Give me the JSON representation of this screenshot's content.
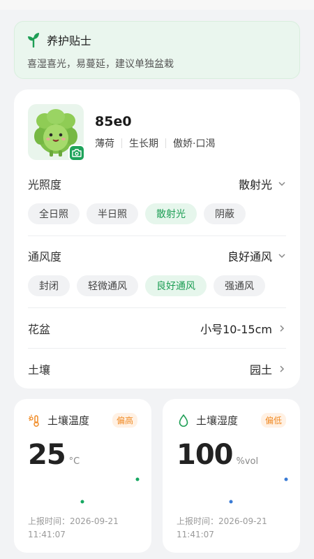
{
  "tip": {
    "title": "养护贴士",
    "text": "喜湿喜光，易蔓延，建议单独盆栽"
  },
  "plant": {
    "name": "85e0",
    "tags": [
      "薄荷",
      "生长期",
      "傲娇·口渴"
    ]
  },
  "light": {
    "label": "光照度",
    "value": "散射光",
    "options": [
      "全日照",
      "半日照",
      "散射光",
      "阴蔽"
    ],
    "selected_index": 2
  },
  "ventilation": {
    "label": "通风度",
    "value": "良好通风",
    "options": [
      "封闭",
      "轻微通风",
      "良好通风",
      "强通风"
    ],
    "selected_index": 2
  },
  "pot": {
    "label": "花盆",
    "value": "小号10-15cm"
  },
  "soil": {
    "label": "土壤",
    "value": "园土"
  },
  "temperature": {
    "title": "土壤温度",
    "badge": "偏高",
    "value": "25",
    "unit": "°C",
    "time_label": "上报时间：",
    "date": "2026-09-21",
    "time": "11:41:07",
    "color": "#16a862"
  },
  "humidity": {
    "title": "土壤湿度",
    "badge": "偏低",
    "value": "100",
    "unit": "%vol",
    "time_label": "上报时间：",
    "date": "2026-09-21",
    "time": "11:41:07",
    "color": "#3a7bd5"
  },
  "colors": {
    "accent_green": "#1e9e55",
    "warning_orange": "#f08a24"
  }
}
